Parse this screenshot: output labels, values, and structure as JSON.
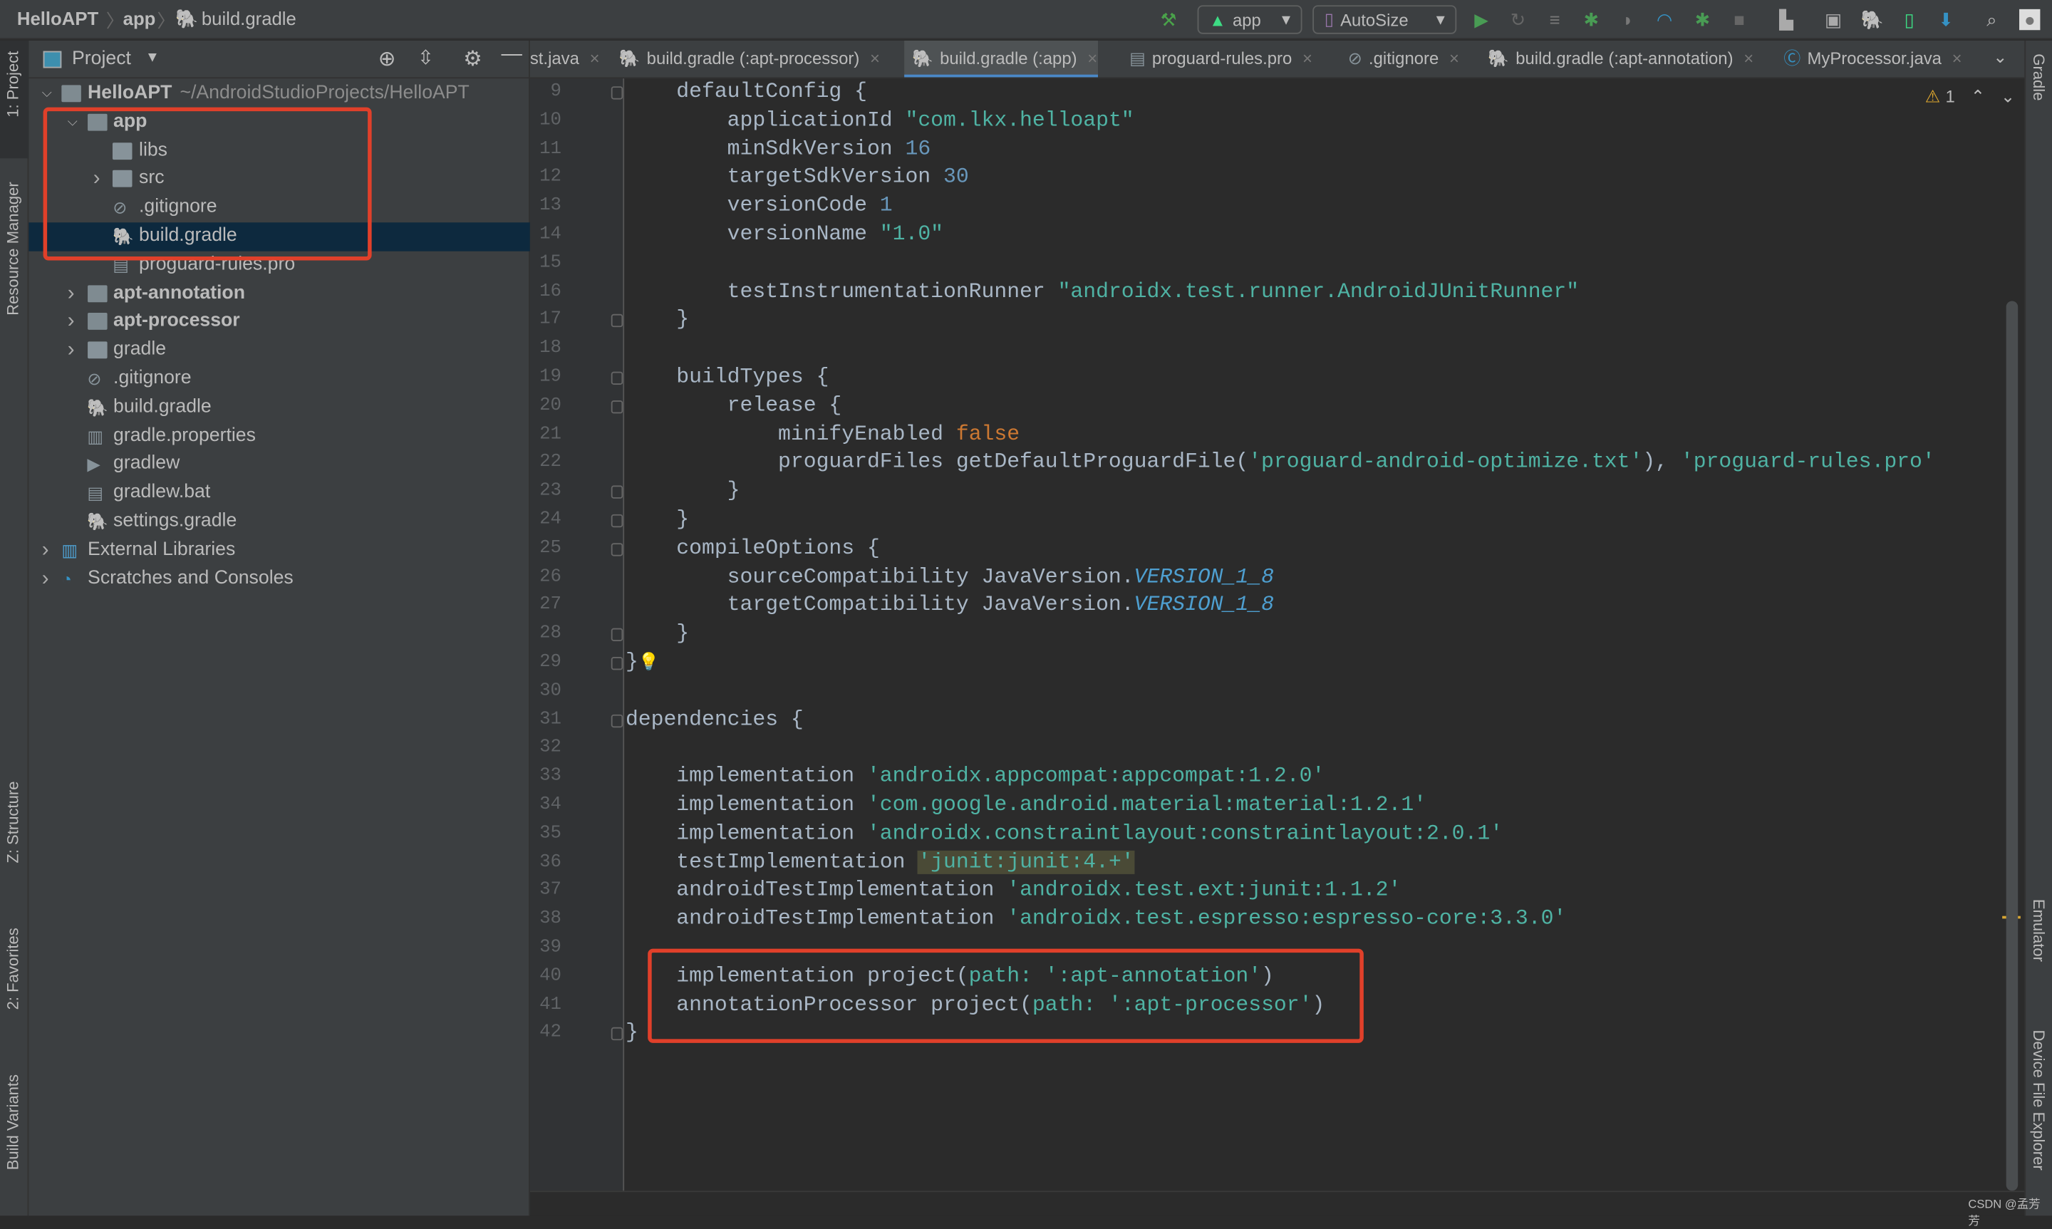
{
  "navbar": {
    "crumbs": [
      "HelloAPT",
      "app",
      "build.gradle"
    ],
    "run_config": "app",
    "device": "AutoSize"
  },
  "project_panel": {
    "title": "Project",
    "tree": [
      {
        "label": "HelloAPT",
        "suffix": "~/AndroidStudioProjects/HelloAPT",
        "level": 0,
        "arrow": "down",
        "icon": "module-folder",
        "bold": true
      },
      {
        "label": "app",
        "level": 1,
        "arrow": "down",
        "icon": "module-folder",
        "bold": true
      },
      {
        "label": "libs",
        "level": 2,
        "icon": "folder"
      },
      {
        "label": "src",
        "level": 2,
        "arrow": "right",
        "icon": "folder"
      },
      {
        "label": ".gitignore",
        "level": 2,
        "icon": "ignore-file"
      },
      {
        "label": "build.gradle",
        "level": 2,
        "icon": "gradle",
        "selected": true
      },
      {
        "label": "proguard-rules.pro",
        "level": 2,
        "icon": "text-file"
      },
      {
        "label": "apt-annotation",
        "level": 1,
        "arrow": "right",
        "icon": "module-folder",
        "bold": true
      },
      {
        "label": "apt-processor",
        "level": 1,
        "arrow": "right",
        "icon": "module-folder",
        "bold": true
      },
      {
        "label": "gradle",
        "level": 1,
        "arrow": "right",
        "icon": "folder"
      },
      {
        "label": ".gitignore",
        "level": 1,
        "icon": "ignore-file"
      },
      {
        "label": "build.gradle",
        "level": 1,
        "icon": "gradle"
      },
      {
        "label": "gradle.properties",
        "level": 1,
        "icon": "properties-file"
      },
      {
        "label": "gradlew",
        "level": 1,
        "icon": "script-file"
      },
      {
        "label": "gradlew.bat",
        "level": 1,
        "icon": "text-file"
      },
      {
        "label": "settings.gradle",
        "level": 1,
        "icon": "gradle"
      },
      {
        "label": "External Libraries",
        "level": 0,
        "arrow": "right",
        "icon": "libraries"
      },
      {
        "label": "Scratches and Consoles",
        "level": 0,
        "arrow": "right",
        "icon": "scratches"
      }
    ]
  },
  "tabs": [
    {
      "label": "st.java",
      "icon": "java"
    },
    {
      "label": "build.gradle (:apt-processor)",
      "icon": "gradle"
    },
    {
      "label": "build.gradle (:app)",
      "icon": "gradle",
      "active": true
    },
    {
      "label": "proguard-rules.pro",
      "icon": "text-file"
    },
    {
      "label": ".gitignore",
      "icon": "ignore-file"
    },
    {
      "label": "build.gradle (:apt-annotation)",
      "icon": "gradle"
    },
    {
      "label": "MyProcessor.java",
      "icon": "java-class"
    }
  ],
  "editor": {
    "warning_count": "1",
    "lines": [
      {
        "n": "9",
        "fold": true,
        "segs": [
          [
            "    defaultConfig {",
            "p"
          ]
        ]
      },
      {
        "n": "10",
        "segs": [
          [
            "        applicationId ",
            "p"
          ],
          [
            "\"com.lkx.helloapt\"",
            "s"
          ]
        ]
      },
      {
        "n": "11",
        "segs": [
          [
            "        minSdkVersion ",
            "p"
          ],
          [
            "16",
            "n"
          ]
        ]
      },
      {
        "n": "12",
        "segs": [
          [
            "        targetSdkVersion ",
            "p"
          ],
          [
            "30",
            "n"
          ]
        ]
      },
      {
        "n": "13",
        "segs": [
          [
            "        versionCode ",
            "p"
          ],
          [
            "1",
            "n"
          ]
        ]
      },
      {
        "n": "14",
        "segs": [
          [
            "        versionName ",
            "p"
          ],
          [
            "\"1.0\"",
            "s"
          ]
        ]
      },
      {
        "n": "15",
        "segs": []
      },
      {
        "n": "16",
        "segs": [
          [
            "        testInstrumentationRunner ",
            "p"
          ],
          [
            "\"androidx.test.runner.AndroidJUnitRunner\"",
            "s"
          ]
        ]
      },
      {
        "n": "17",
        "fold": true,
        "segs": [
          [
            "    }",
            "p"
          ]
        ]
      },
      {
        "n": "18",
        "segs": []
      },
      {
        "n": "19",
        "fold": true,
        "segs": [
          [
            "    buildTypes {",
            "p"
          ]
        ]
      },
      {
        "n": "20",
        "fold": true,
        "segs": [
          [
            "        release {",
            "p"
          ]
        ]
      },
      {
        "n": "21",
        "segs": [
          [
            "            minifyEnabled ",
            "p"
          ],
          [
            "false",
            "k"
          ]
        ]
      },
      {
        "n": "22",
        "segs": [
          [
            "            proguardFiles getDefaultProguardFile(",
            "p"
          ],
          [
            "'proguard-android-optimize.txt'",
            "s"
          ],
          [
            "), ",
            "p"
          ],
          [
            "'proguard-rules.pro'",
            "s"
          ]
        ]
      },
      {
        "n": "23",
        "fold": true,
        "segs": [
          [
            "        }",
            "p"
          ]
        ]
      },
      {
        "n": "24",
        "fold": true,
        "segs": [
          [
            "    }",
            "p"
          ]
        ]
      },
      {
        "n": "25",
        "fold": true,
        "segs": [
          [
            "    compileOptions {",
            "p"
          ]
        ]
      },
      {
        "n": "26",
        "segs": [
          [
            "        sourceCompatibility JavaVersion.",
            "p"
          ],
          [
            "VERSION_1_8",
            "i"
          ]
        ]
      },
      {
        "n": "27",
        "segs": [
          [
            "        targetCompatibility JavaVersion.",
            "p"
          ],
          [
            "VERSION_1_8",
            "i"
          ]
        ]
      },
      {
        "n": "28",
        "fold": true,
        "segs": [
          [
            "    }",
            "p"
          ]
        ]
      },
      {
        "n": "29",
        "fold": true,
        "bulb": true,
        "segs": [
          [
            "}",
            "p"
          ]
        ]
      },
      {
        "n": "30",
        "segs": []
      },
      {
        "n": "31",
        "fold": true,
        "segs": [
          [
            "dependencies {",
            "p"
          ]
        ]
      },
      {
        "n": "32",
        "segs": []
      },
      {
        "n": "33",
        "segs": [
          [
            "    implementation ",
            "p"
          ],
          [
            "'androidx.appcompat:appcompat:1.2.0'",
            "s"
          ]
        ]
      },
      {
        "n": "34",
        "segs": [
          [
            "    implementation ",
            "p"
          ],
          [
            "'com.google.android.material:material:1.2.1'",
            "s"
          ]
        ]
      },
      {
        "n": "35",
        "segs": [
          [
            "    implementation ",
            "p"
          ],
          [
            "'androidx.constraintlayout:constraintlayout:2.0.1'",
            "s"
          ]
        ]
      },
      {
        "n": "36",
        "segs": [
          [
            "    testImplementation ",
            "p"
          ],
          [
            "'junit:junit:4.+'",
            "hl"
          ]
        ]
      },
      {
        "n": "37",
        "segs": [
          [
            "    androidTestImplementation ",
            "p"
          ],
          [
            "'androidx.test.ext:junit:1.1.2'",
            "s"
          ]
        ]
      },
      {
        "n": "38",
        "segs": [
          [
            "    androidTestImplementation ",
            "p"
          ],
          [
            "'androidx.test.espresso:espresso-core:3.3.0'",
            "s"
          ]
        ]
      },
      {
        "n": "39",
        "segs": []
      },
      {
        "n": "40",
        "segs": [
          [
            "    implementation project(",
            "p"
          ],
          [
            "path: ",
            "pm"
          ],
          [
            "':apt-annotation'",
            "s"
          ],
          [
            ")",
            "p"
          ]
        ]
      },
      {
        "n": "41",
        "segs": [
          [
            "    annotationProcessor project(",
            "p"
          ],
          [
            "path: ",
            "pm"
          ],
          [
            "':apt-processor'",
            "s"
          ],
          [
            ")",
            "p"
          ]
        ]
      },
      {
        "n": "42",
        "fold": true,
        "segs": [
          [
            "}",
            "p"
          ]
        ]
      }
    ]
  },
  "tool_windows": {
    "left": [
      "1: Project",
      "Resource Manager",
      "Z: Structure",
      "2: Favorites",
      "Build Variants"
    ],
    "right": [
      "Gradle",
      "Emulator",
      "Device File Explorer"
    ]
  },
  "watermark": "CSDN @孟芳芳",
  "colors": {
    "highlight_box": "#e0402a",
    "selection": "#0d293e",
    "tab_underline": "#4a88c7"
  }
}
